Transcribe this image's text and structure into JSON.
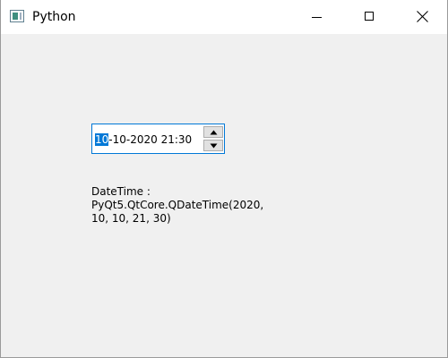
{
  "window": {
    "title": "Python",
    "icon": "python-window-icon",
    "controls": {
      "minimize": "minimize-icon",
      "maximize": "maximize-icon",
      "close": "close-icon"
    }
  },
  "datetime_edit": {
    "selected_section": "10",
    "rest_text": "-10-2020 21:30",
    "up_arrow": "arrow-up-icon",
    "down_arrow": "arrow-down-icon"
  },
  "label": {
    "line1": "DateTime :",
    "line2": "PyQt5.QtCore.QDateTime(2020,",
    "line3": "10, 10, 21, 30)"
  },
  "colors": {
    "selection": "#0078d7",
    "window_bg": "#f0f0f0",
    "titlebar_bg": "#ffffff"
  }
}
